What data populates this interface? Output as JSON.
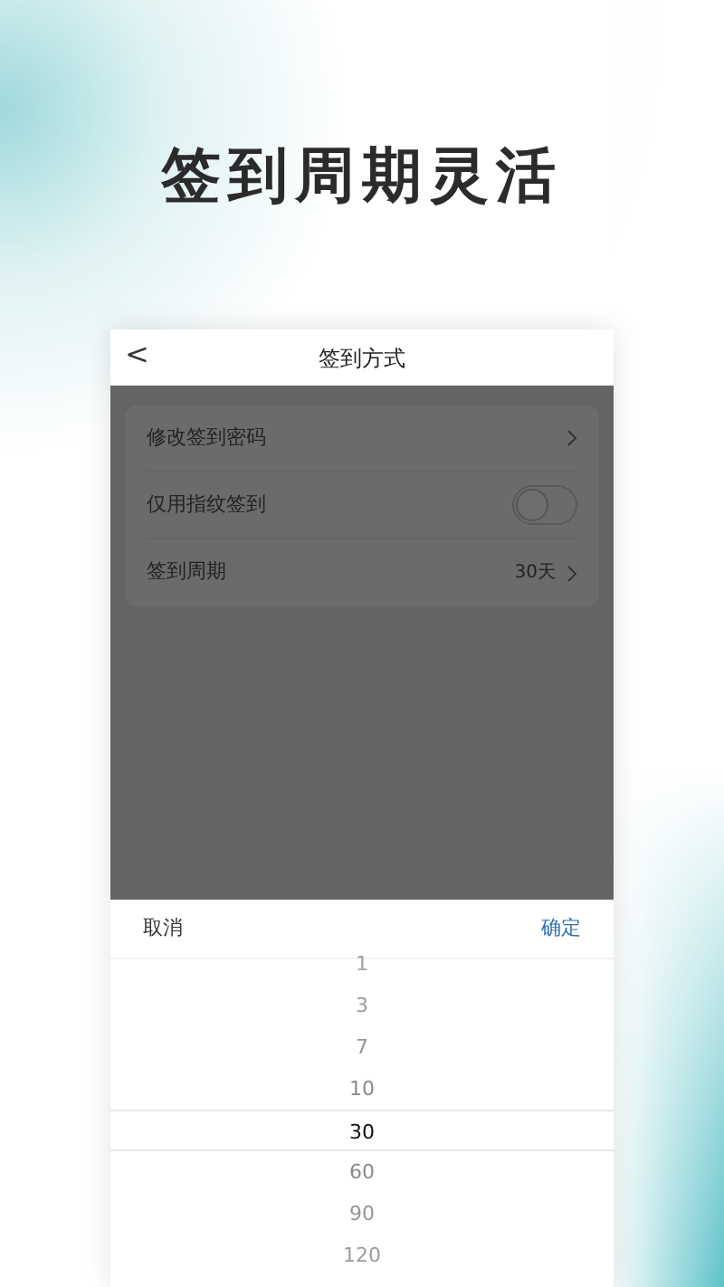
{
  "headline": "签到周期灵活",
  "header": {
    "back": "<",
    "title": "签到方式"
  },
  "settings": [
    {
      "kind": "link",
      "label": "修改签到密码"
    },
    {
      "kind": "switch",
      "label": "仅用指纹签到",
      "on": false
    },
    {
      "kind": "link",
      "label": "签到周期",
      "value": "30天"
    }
  ],
  "picker": {
    "cancel": "取消",
    "confirm": "确定",
    "options": [
      {
        "label": "1",
        "selected": false
      },
      {
        "label": "3",
        "selected": false
      },
      {
        "label": "7",
        "selected": false
      },
      {
        "label": "10",
        "selected": false
      },
      {
        "label": "30",
        "selected": true
      },
      {
        "label": "60",
        "selected": false
      },
      {
        "label": "90",
        "selected": false
      },
      {
        "label": "120",
        "selected": false
      }
    ]
  }
}
